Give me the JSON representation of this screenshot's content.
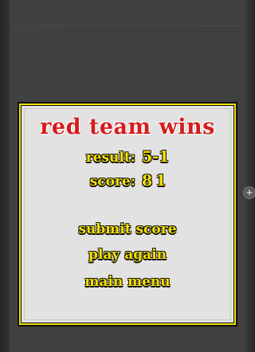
{
  "dialog": {
    "title": "red team wins",
    "result_label": "result:",
    "result_value": "5-1",
    "score_label": "score:",
    "score_value": "81"
  },
  "menu": {
    "submit_score": "submit score",
    "play_again": "play again",
    "main_menu": "main menu"
  },
  "side_button_glyph": "+",
  "colors": {
    "title_red": "#d51c1c",
    "text_yellow": "#f4e000",
    "dialog_bg": "#e2e2e2",
    "dialog_border": "#f0e000",
    "game_bg": "#3f3f3f"
  }
}
